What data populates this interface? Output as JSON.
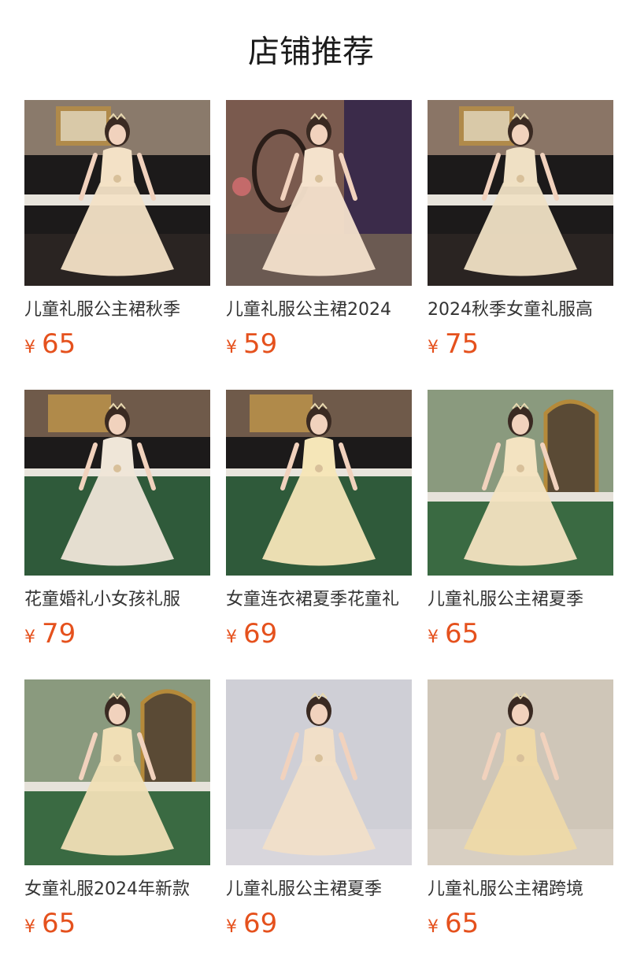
{
  "title": "店铺推荐",
  "products": [
    {
      "name": "儿童礼服公主裙秋季",
      "currency": "¥",
      "price": "65",
      "scene": "piano",
      "dress": "#f3e1c6",
      "wall": "#8a7a6b",
      "floor": "#2a2624"
    },
    {
      "name": "儿童礼服公主裙2024",
      "currency": "¥",
      "price": "59",
      "scene": "chair",
      "dress": "#f4e2cc",
      "wall": "#7a5a4e",
      "floor": "#6b5a52"
    },
    {
      "name": "2024秋季女童礼服高",
      "currency": "¥",
      "price": "75",
      "scene": "piano",
      "dress": "#efe0c4",
      "wall": "#8a7566",
      "floor": "#3a3330"
    },
    {
      "name": "花童婚礼小女孩礼服",
      "currency": "¥",
      "price": "79",
      "scene": "green",
      "dress": "#efe6d8",
      "wall": "#6f5a4a",
      "floor": "#2f5a3a"
    },
    {
      "name": "女童连衣裙夏季花童礼",
      "currency": "¥",
      "price": "69",
      "scene": "green",
      "dress": "#f5e6b8",
      "wall": "#6f5a4a",
      "floor": "#2f5a3a"
    },
    {
      "name": "儿童礼服公主裙夏季",
      "currency": "¥",
      "price": "65",
      "scene": "mirror",
      "dress": "#f3e3c1",
      "wall": "#5d6e55",
      "floor": "#3a6a42"
    },
    {
      "name": "女童礼服2024年新款",
      "currency": "¥",
      "price": "65",
      "scene": "mirror",
      "dress": "#f0dfb6",
      "wall": "#5d6e55",
      "floor": "#3a6a42"
    },
    {
      "name": "儿童礼服公主裙夏季",
      "currency": "¥",
      "price": "69",
      "scene": "studio",
      "dress": "#f1dfc8",
      "wall": "#cfcfd6",
      "floor": "#d8d6dc"
    },
    {
      "name": "儿童礼服公主裙跨境",
      "currency": "¥",
      "price": "65",
      "scene": "studio",
      "dress": "#eed9a8",
      "wall": "#cfc6b8",
      "floor": "#d8cfc2"
    }
  ]
}
